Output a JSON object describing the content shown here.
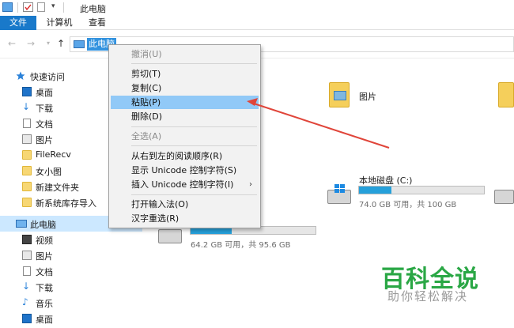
{
  "window": {
    "title": "此电脑"
  },
  "ribbon": {
    "tabs": [
      {
        "label": "文件"
      },
      {
        "label": "计算机"
      },
      {
        "label": "查看"
      }
    ]
  },
  "nav": {
    "address": "此电脑"
  },
  "sidebar": {
    "items": [
      {
        "label": "快速访问",
        "icon": "star-icon"
      },
      {
        "label": "桌面",
        "icon": "desktop-icon"
      },
      {
        "label": "下载",
        "icon": "download-icon"
      },
      {
        "label": "文档",
        "icon": "document-icon"
      },
      {
        "label": "图片",
        "icon": "picture-icon"
      },
      {
        "label": "FileRecv",
        "icon": "folder-icon"
      },
      {
        "label": "女小图",
        "icon": "folder-icon"
      },
      {
        "label": "新建文件夹",
        "icon": "folder-icon"
      },
      {
        "label": "新系统库存导入",
        "icon": "folder-icon"
      },
      {
        "label": "此电脑",
        "icon": "computer-icon"
      },
      {
        "label": "视频",
        "icon": "video-icon"
      },
      {
        "label": "图片",
        "icon": "picture-icon"
      },
      {
        "label": "文档",
        "icon": "document-icon"
      },
      {
        "label": "下载",
        "icon": "download-icon"
      },
      {
        "label": "音乐",
        "icon": "music-icon"
      },
      {
        "label": "桌面",
        "icon": "desktop-icon"
      }
    ]
  },
  "main": {
    "folder_label": "图片",
    "drive_c": {
      "name": "本地磁盘 (C:)",
      "space": "74.0 GB 可用，共 100 GB",
      "used_fraction": 0.26
    },
    "drive_d": {
      "space": "64.2 GB 可用，共 95.6 GB",
      "used_fraction": 0.33
    }
  },
  "context_menu": {
    "items": [
      {
        "label": "撤消(U)",
        "disabled": true
      },
      {
        "label": "剪切(T)"
      },
      {
        "label": "复制(C)"
      },
      {
        "label": "粘贴(P)",
        "highlighted": true
      },
      {
        "label": "删除(D)"
      },
      {
        "label": "全选(A)",
        "disabled": true
      },
      {
        "label": "从右到左的阅读顺序(R)"
      },
      {
        "label": "显示 Unicode 控制字符(S)"
      },
      {
        "label": "插入 Unicode 控制字符(I)",
        "submenu": true
      },
      {
        "label": "打开输入法(O)"
      },
      {
        "label": "汉字重选(R)"
      }
    ],
    "submenu_glyph": "›"
  },
  "annotation": {
    "arrow_color": "#e0453a"
  },
  "watermark": {
    "title": "百科全说",
    "subtitle": "助你轻松解决"
  },
  "colors": {
    "accent": "#1979ca",
    "highlight": "#91c9f7",
    "watermark": "#2aa745"
  }
}
